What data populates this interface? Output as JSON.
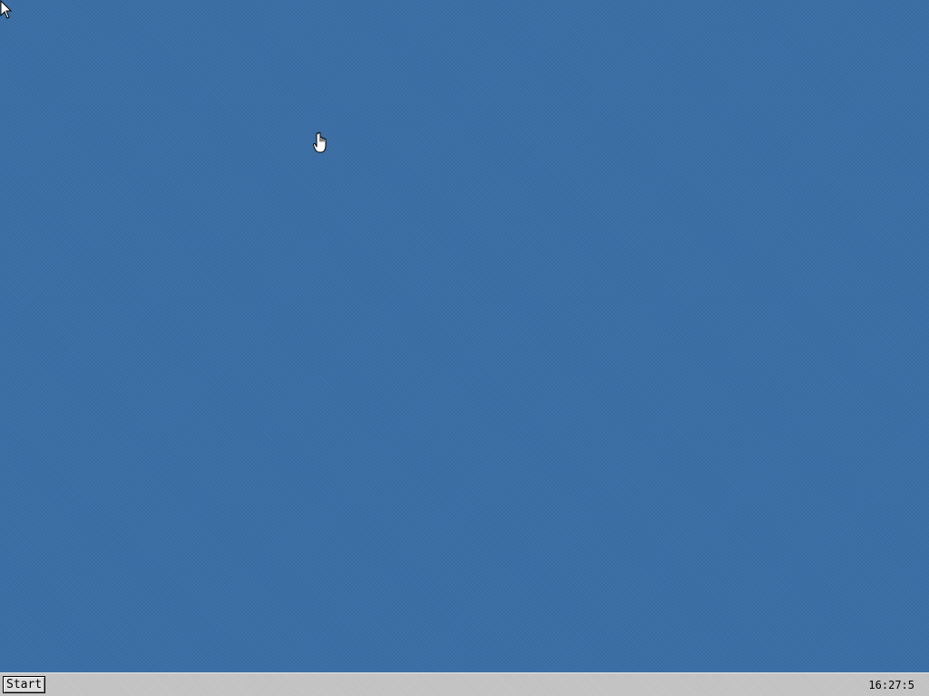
{
  "desktop": {
    "background_color": "#3a6ea5"
  },
  "taskbar": {
    "start_label": "Start",
    "clock": "16:27:5",
    "background_color": "#c8c8c8"
  },
  "cursors": {
    "arrow": "arrow-pointer-icon",
    "hand": "hand-pointer-icon"
  }
}
